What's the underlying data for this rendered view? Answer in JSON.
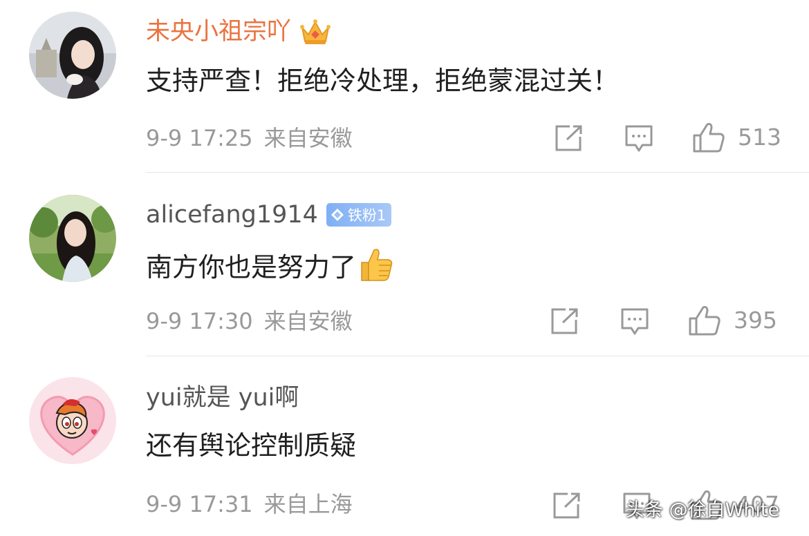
{
  "comments": [
    {
      "username": "未央小祖宗吖",
      "badge": "crown-icon",
      "text": "支持严查！拒绝冷处理，拒绝蒙混过关！",
      "date": "9-9 17:25",
      "location": "来自安徽",
      "likes": "513"
    },
    {
      "username": "alicefang1914",
      "badge_text": "铁粉1",
      "text": "南方你也是努力了",
      "date": "9-9 17:30",
      "location": "来自安徽",
      "likes": "395"
    },
    {
      "username": "yui就是 yui啊",
      "text": "还有舆论控制质疑",
      "date": "9-9 17:31",
      "location": "来自上海",
      "likes": "407"
    }
  ],
  "watermark": "头条 @徐白White",
  "colors": {
    "vip_username": "#eb7340",
    "username": "#555555",
    "meta": "#999999",
    "fan_badge": "#7fb0f5"
  },
  "icons": [
    "share-icon",
    "comment-icon",
    "like-icon",
    "crown-icon",
    "diamond-icon",
    "thumbs-up-emoji"
  ]
}
